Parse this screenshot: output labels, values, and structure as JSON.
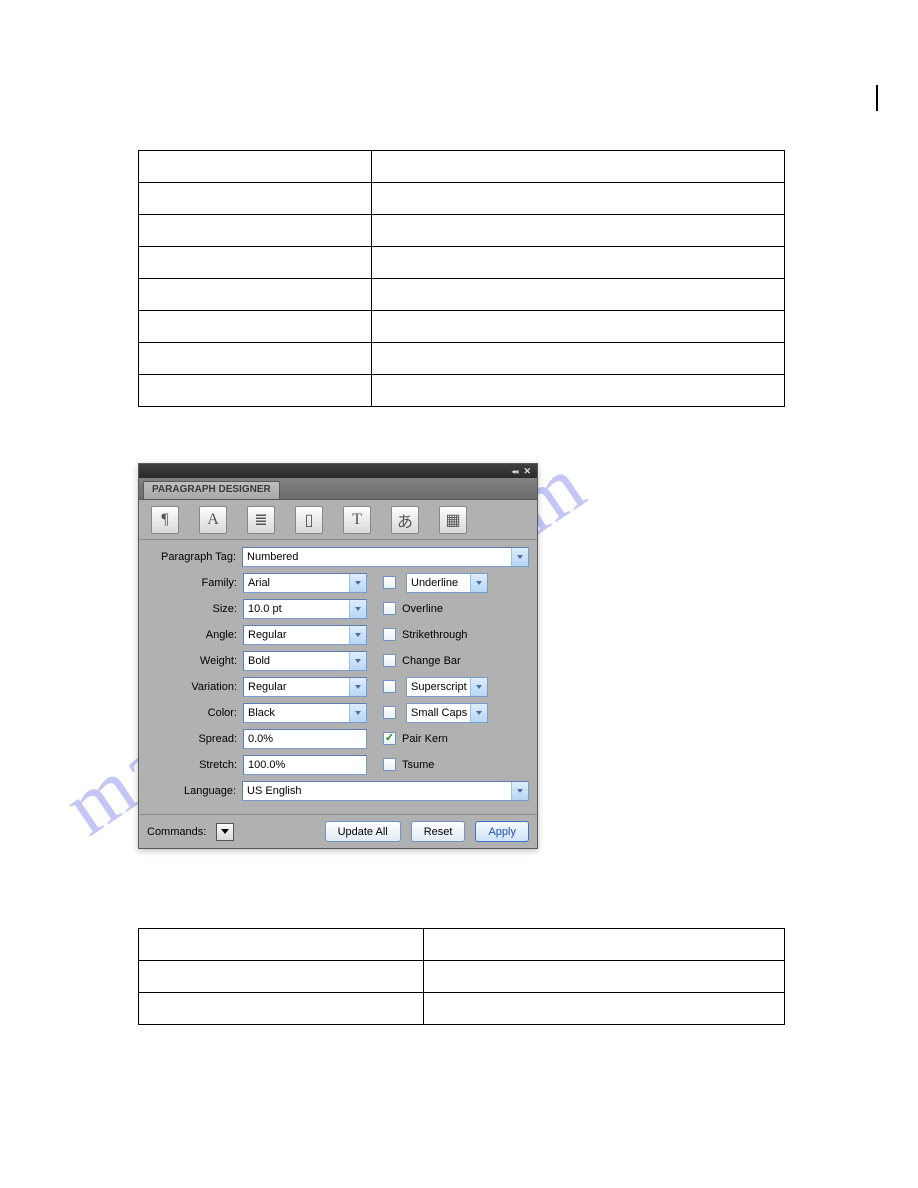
{
  "watermark": "manualshive.com",
  "panel": {
    "title": "PARAGRAPH DESIGNER",
    "icons": [
      "¶",
      "A",
      "≣",
      "▯",
      "T",
      "あ",
      "▦"
    ],
    "tag_label": "Paragraph Tag:",
    "tag_value": "Numbered",
    "family_label": "Family:",
    "family_value": "Arial",
    "size_label": "Size:",
    "size_value": "10.0 pt",
    "angle_label": "Angle:",
    "angle_value": "Regular",
    "weight_label": "Weight:",
    "weight_value": "Bold",
    "variation_label": "Variation:",
    "variation_value": "Regular",
    "color_label": "Color:",
    "color_value": "Black",
    "spread_label": "Spread:",
    "spread_value": "0.0%",
    "stretch_label": "Stretch:",
    "stretch_value": "100.0%",
    "language_label": "Language:",
    "language_value": "US English",
    "underline": "Underline",
    "overline": "Overline",
    "strike": "Strikethrough",
    "changebar": "Change Bar",
    "superscript": "Superscript",
    "smallcaps": "Small Caps",
    "pairkern": "Pair Kern",
    "tsume": "Tsume",
    "commands_label": "Commands:",
    "update_all": "Update All",
    "reset": "Reset",
    "apply": "Apply"
  },
  "table1_rows": 8,
  "table2_rows": 3
}
